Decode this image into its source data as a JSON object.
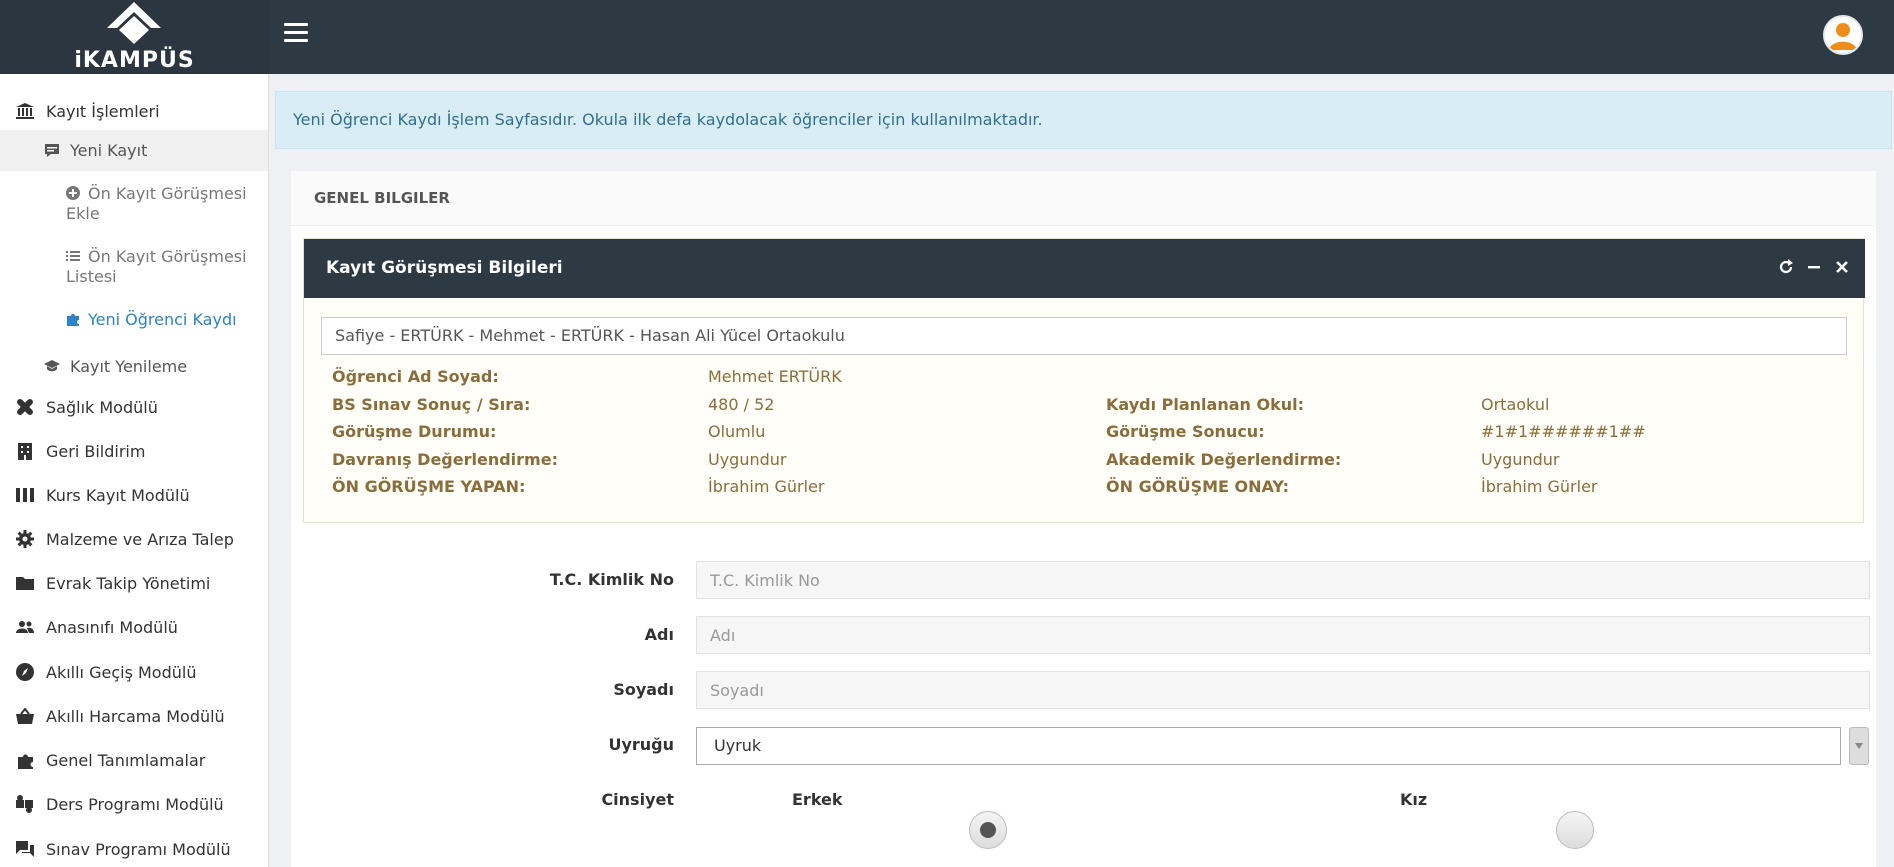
{
  "app": {
    "logo_text": "iKAMPÜS"
  },
  "sidebar": {
    "items": [
      {
        "label": "Kayıt İşlemleri",
        "icon": "bank-icon"
      },
      {
        "label": "Yeni Kayıt",
        "icon": "message-square-icon"
      },
      {
        "label": "Ön Kayıt Görüşmesi Ekle",
        "icon": "plus-circle-icon"
      },
      {
        "label": "Ön Kayıt Görüşmesi Listesi",
        "icon": "list-icon"
      },
      {
        "label": "Yeni Öğrenci Kaydı",
        "icon": "puzzle-icon"
      },
      {
        "label": "Kayıt Yenileme",
        "icon": "graduation-cap-icon"
      },
      {
        "label": "Sağlık Modülü",
        "icon": "bandage-icon"
      },
      {
        "label": "Geri Bildirim",
        "icon": "building-icon"
      },
      {
        "label": "Kurs Kayıt Modülü",
        "icon": "columns-icon"
      },
      {
        "label": "Malzeme ve Arıza Talep",
        "icon": "gear-icon"
      },
      {
        "label": "Evrak Takip Yönetimi",
        "icon": "folder-icon"
      },
      {
        "label": "Anasınıfı Modülü",
        "icon": "users-icon"
      },
      {
        "label": "Akıllı Geçiş Modülü",
        "icon": "compass-icon"
      },
      {
        "label": "Akıllı Harcama Modülü",
        "icon": "basket-icon"
      },
      {
        "label": "Genel Tanımlamalar",
        "icon": "puzzle-icon"
      },
      {
        "label": "Ders Programı Modülü",
        "icon": "puzzle-piece-icon"
      },
      {
        "label": "Sınav Programı Modülü",
        "icon": "chat-icon"
      }
    ]
  },
  "alert": {
    "text": "Yeni Öğrenci Kaydı İşlem Sayfasıdır. Okula ilk defa kaydolacak öğrenciler için kullanılmaktadır."
  },
  "panel": {
    "title": "GENEL BILGILER"
  },
  "card": {
    "title": "Kayıt Görüşmesi Bilgileri",
    "selected_record": "Safiye - ERTÜRK - Mehmet - ERTÜRK - Hasan Ali Yücel Ortaokulu",
    "fields": {
      "ogrenci_label": "Öğrenci Ad Soyad:",
      "ogrenci_value": "Mehmet ERTÜRK",
      "bs_label": "BS Sınav Sonuç / Sıra:",
      "bs_value": "480 / 52",
      "okul_label": "Kaydı Planlanan Okul:",
      "okul_value": "Ortaokul",
      "durum_label": "Görüşme Durumu:",
      "durum_value": "Olumlu",
      "sonuc_label": "Görüşme Sonucu:",
      "sonuc_value": "#1#1######1##",
      "davranis_label": "Davranış Değerlendirme:",
      "davranis_value": "Uygundur",
      "akademik_label": "Akademik Değerlendirme:",
      "akademik_value": "Uygundur",
      "yapan_label": "ÖN GÖRÜŞME YAPAN:",
      "yapan_value": "İbrahim Gürler",
      "onay_label": "ÖN GÖRÜŞME ONAY:",
      "onay_value": "İbrahim Gürler"
    }
  },
  "form": {
    "tc_label": "T.C. Kimlik No",
    "tc_placeholder": "T.C. Kimlik No",
    "adi_label": "Adı",
    "adi_placeholder": "Adı",
    "soyadi_label": "Soyadı",
    "soyadi_placeholder": "Soyadı",
    "uyruk_label": "Uyruğu",
    "uyruk_value": "Uyruk",
    "cinsiyet_label": "Cinsiyet",
    "erkek_label": "Erkek",
    "kiz_label": "Kız"
  },
  "colors": {
    "topbar": "#2d3a44",
    "accent_link": "#2e82c8",
    "info_text": "#8a6d3b",
    "alert_bg": "#d9edf7"
  }
}
